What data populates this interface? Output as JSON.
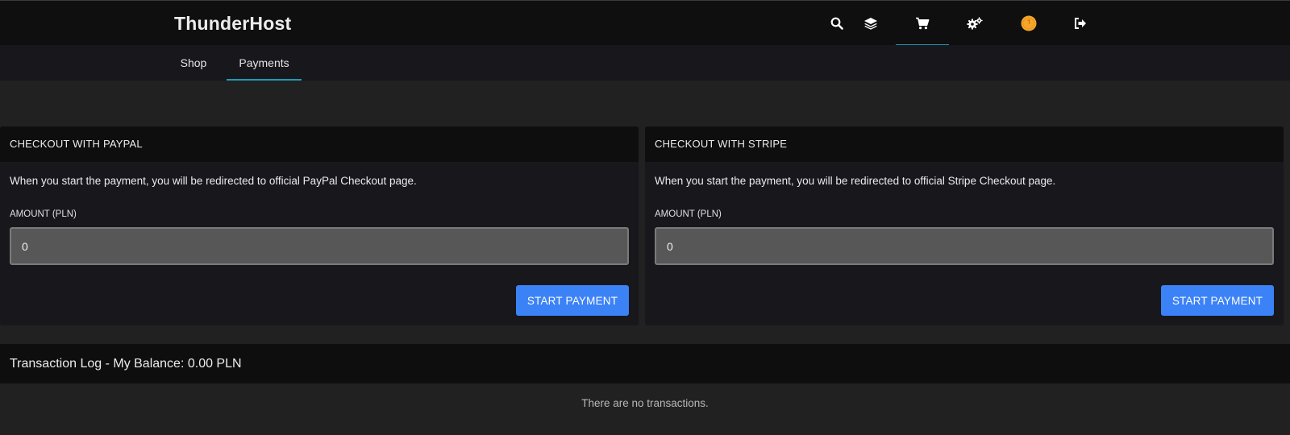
{
  "brand": "ThunderHost",
  "nav_icons": [
    {
      "name": "search-icon"
    },
    {
      "name": "layers-icon"
    },
    {
      "name": "cart-icon",
      "active": true
    },
    {
      "name": "cogs-icon"
    },
    {
      "name": "coin-icon",
      "color": "#f4a52a"
    },
    {
      "name": "sign-out-icon"
    }
  ],
  "subnav": {
    "tabs": [
      {
        "label": "Shop"
      },
      {
        "label": "Payments",
        "active": true
      }
    ]
  },
  "paypal": {
    "title": "CHECKOUT WITH PAYPAL",
    "description": "When you start the payment, you will be redirected to official PayPal Checkout page.",
    "amount_label": "AMOUNT (PLN)",
    "amount_value": "0",
    "button": "START PAYMENT"
  },
  "stripe": {
    "title": "CHECKOUT WITH STRIPE",
    "description": "When you start the payment, you will be redirected to official Stripe Checkout page.",
    "amount_label": "AMOUNT (PLN)",
    "amount_value": "0",
    "button": "START PAYMENT"
  },
  "transaction_log": {
    "title": "Transaction Log - My Balance: 0.00 PLN",
    "empty_message": "There are no transactions."
  },
  "colors": {
    "accent": "#1e9bb8",
    "button": "#3b82f6",
    "coin": "#f4a52a"
  }
}
